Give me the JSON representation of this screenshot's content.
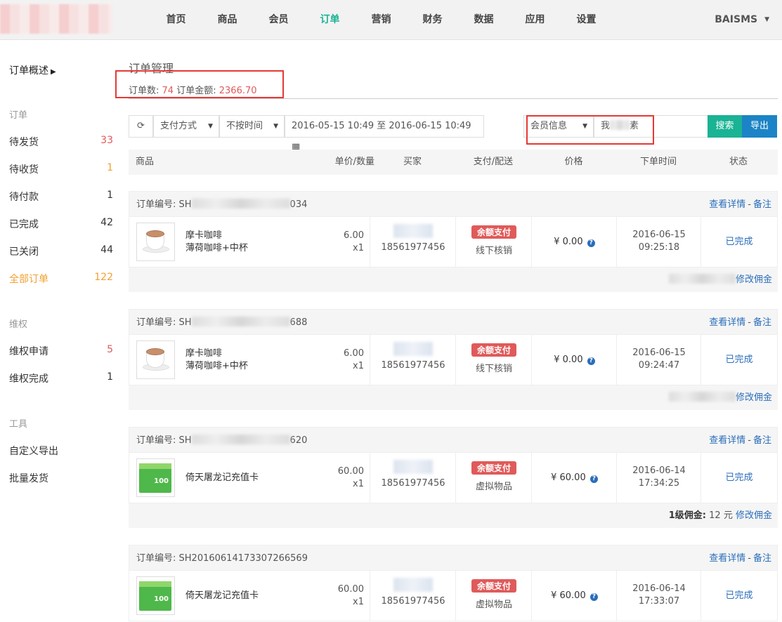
{
  "nav": {
    "items": [
      "首页",
      "商品",
      "会员",
      "订单",
      "营销",
      "财务",
      "数据",
      "应用",
      "设置"
    ],
    "active_index": 3,
    "user": "BAISMS"
  },
  "sidebar": {
    "overview": "订单概述",
    "groups": [
      {
        "title": "订单",
        "items": [
          {
            "label": "待发货",
            "count": "33"
          },
          {
            "label": "待收货",
            "count": "1"
          },
          {
            "label": "待付款",
            "count": "1"
          },
          {
            "label": "已完成",
            "count": "42"
          },
          {
            "label": "已关闭",
            "count": "44"
          },
          {
            "label": "全部订单",
            "count": "122"
          }
        ]
      },
      {
        "title": "维权",
        "items": [
          {
            "label": "维权申请",
            "count": "5"
          },
          {
            "label": "维权完成",
            "count": "1"
          }
        ]
      },
      {
        "title": "工具",
        "items": [
          {
            "label": "自定义导出",
            "count": ""
          },
          {
            "label": "批量发货",
            "count": ""
          }
        ]
      }
    ]
  },
  "page": {
    "title": "订单管理",
    "order_count_label": "订单数:",
    "order_count": "74",
    "order_amount_label": "订单金额:",
    "order_amount": "2366.70"
  },
  "filters": {
    "pay_method": "支付方式",
    "time_mode": "不按时间",
    "date_range": "2016-05-15 10:49 至 2016-06-15 10:49",
    "member_field": "会员信息",
    "search_value_prefix": "我",
    "search_value_suffix": "素",
    "search_button": "搜索",
    "export_button": "导出"
  },
  "table_headers": [
    "商品",
    "单价/数量",
    "买家",
    "支付/配送",
    "价格",
    "下单时间",
    "状态"
  ],
  "order_labels": {
    "no_prefix": "订单编号: ",
    "detail_link": "查看详情",
    "separator": "-",
    "note_link": "备注",
    "modify_commission": "修改佣金",
    "currency": "¥"
  },
  "orders": [
    {
      "no_start": "SH",
      "no_end": "034",
      "product": "摩卡咖啡",
      "spec": "薄荷咖啡+中杯",
      "unit_price": "6.00",
      "qty": "x1",
      "buyer_phone": "18561977456",
      "pay_badge": "余额支付",
      "delivery": "线下核销",
      "amount": "¥ 0.00",
      "date": "2016-06-15",
      "time": "09:25:18",
      "status": "已完成",
      "commission_label": "",
      "commission_value": ""
    },
    {
      "no_start": "SH",
      "no_end": "688",
      "product": "摩卡咖啡",
      "spec": "薄荷咖啡+中杯",
      "unit_price": "6.00",
      "qty": "x1",
      "buyer_phone": "18561977456",
      "pay_badge": "余额支付",
      "delivery": "线下核销",
      "amount": "¥ 0.00",
      "date": "2016-06-15",
      "time": "09:24:47",
      "status": "已完成",
      "commission_label": "",
      "commission_value": ""
    },
    {
      "no_start": "SH",
      "no_end": "620",
      "product": "倚天屠龙记充值卡",
      "spec": "",
      "unit_price": "60.00",
      "qty": "x1",
      "buyer_phone": "18561977456",
      "pay_badge": "余额支付",
      "delivery": "虚拟物品",
      "amount": "¥ 60.00",
      "date": "2016-06-14",
      "time": "17:34:25",
      "status": "已完成",
      "commission_label": "1级佣金:",
      "commission_value": "12 元"
    },
    {
      "no_start": "SH20160614173307266569",
      "no_end": "",
      "product": "倚天屠龙记充值卡",
      "spec": "",
      "unit_price": "60.00",
      "qty": "x1",
      "buyer_phone": "18561977456",
      "pay_badge": "余额支付",
      "delivery": "虚拟物品",
      "amount": "¥ 60.00",
      "date": "2016-06-14",
      "time": "17:33:07",
      "status": "已完成",
      "commission_label": "",
      "commission_value": ""
    }
  ],
  "card_image_text": "100",
  "colors": {
    "accent": "#1ab394",
    "danger": "#e05a5a",
    "link": "#2a6ebb",
    "warning": "#f0a030",
    "highlight_box": "#e53935"
  }
}
